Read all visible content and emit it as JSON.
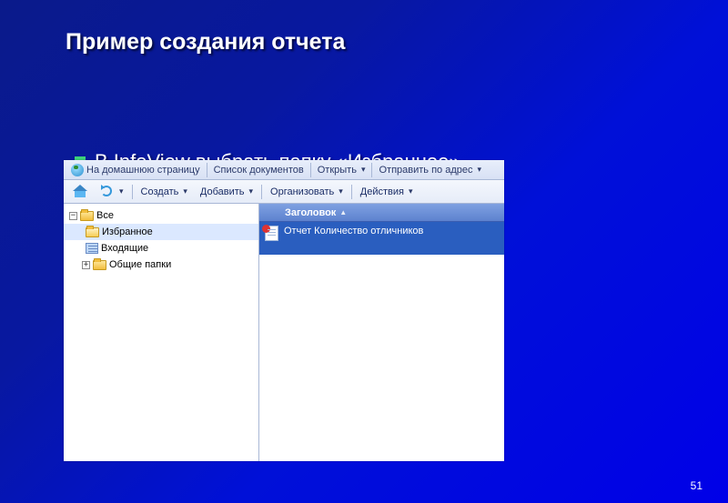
{
  "slide": {
    "title": "Пример создания отчета",
    "bullet": "В InfoView выбрать папку «Избранное»",
    "page_number": "51"
  },
  "app": {
    "top_toolbar": {
      "home": "На домашнюю страницу",
      "docs_list": "Список документов",
      "open": "Открыть",
      "send_to": "Отправить по адрес"
    },
    "action_toolbar": {
      "create": "Создать",
      "add": "Добавить",
      "organize": "Организовать",
      "actions": "Действия"
    },
    "tree": {
      "root": "Все",
      "favorites": "Избранное",
      "inbox": "Входящие",
      "public": "Общие папки"
    },
    "list": {
      "column_header": "Заголовок",
      "item1": "Отчет Количество отличников"
    }
  }
}
